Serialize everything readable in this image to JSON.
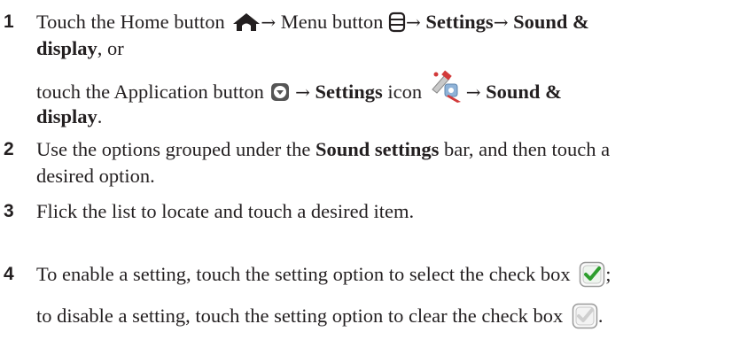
{
  "steps": [
    {
      "number": "1",
      "line1": {
        "t1": "Touch the Home button",
        "t2": "Menu button",
        "t3": "Settings",
        "t4": "Sound &"
      },
      "line2": {
        "bold": "display",
        "rest": ", or"
      },
      "line3": {
        "t1": "touch the Application button",
        "t2": "Settings",
        "t3": "icon",
        "t4": "Sound &"
      },
      "line4": {
        "bold": "display",
        "rest": "."
      }
    },
    {
      "number": "2",
      "line1": {
        "t1": "Use the options grouped under the",
        "bold": "Sound settings",
        "t2": "bar, and then touch a"
      },
      "line2": "desired option."
    },
    {
      "number": "3",
      "line1": "Flick the list to locate and touch a desired item."
    },
    {
      "number": "4",
      "line1": {
        "t1": "To enable a setting, touch the setting option to select the check box",
        "t2": ";"
      },
      "line2": {
        "t1": "to disable a setting, touch the setting option to clear the check box",
        "t2": "."
      }
    }
  ],
  "icons": {
    "home": "home-icon",
    "menu": "menu-icon",
    "application": "application-icon",
    "settings": "settings-icon",
    "checked": "checked-checkbox-icon",
    "unchecked": "cleared-checkbox-icon"
  },
  "colors": {
    "text": "#231f20",
    "check_green": "#2e9e2e"
  }
}
